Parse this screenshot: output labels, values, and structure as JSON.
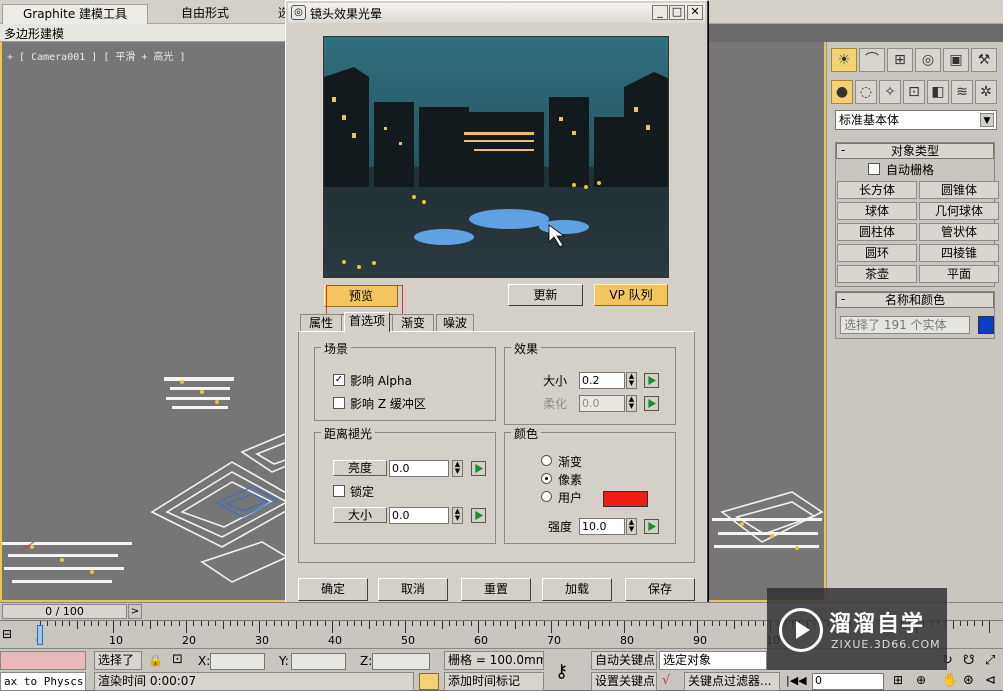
{
  "ribbon": {
    "tabs": [
      "Graphite 建模工具",
      "自由形式",
      "选"
    ],
    "subtab": "多边形建模"
  },
  "viewport": {
    "label": "+ [ Camera001 ] [ 平滑 + 高光 ]"
  },
  "dialog": {
    "title": "镜头效果光晕",
    "window_buttons": [
      "_",
      "□",
      "✕"
    ],
    "preview_button": "预览",
    "update_button": "更新",
    "vp_queue_button": "VP 队列",
    "tabs": [
      "属性",
      "首选项",
      "渐变",
      "噪波"
    ],
    "active_tab": "首选项",
    "scene": {
      "title": "场景",
      "affect_alpha": {
        "label": "影响 Alpha",
        "checked": true
      },
      "affect_z": {
        "label": "影响 Z 缓冲区",
        "checked": false
      }
    },
    "distance_fade": {
      "title": "距离褪光",
      "brightness_label": "亮度",
      "brightness_value": "0.0",
      "lock_label": "锁定",
      "lock_checked": false,
      "size_label": "大小",
      "size_value": "0.0"
    },
    "effect": {
      "title": "效果",
      "size_label": "大小",
      "size_value": "0.2",
      "soften_label": "柔化",
      "soften_value": "0.0"
    },
    "color": {
      "title": "颜色",
      "options": [
        "渐变",
        "像素",
        "用户"
      ],
      "selected": "像素",
      "user_color": "#ee1c14",
      "intensity_label": "强度",
      "intensity_value": "10.0"
    },
    "footer_buttons": [
      "确定",
      "取消",
      "重置",
      "加载",
      "保存"
    ]
  },
  "command_panel": {
    "tab_icons": [
      "sun-icon",
      "curve-icon",
      "hierarchy-icon",
      "motion-icon",
      "display-icon",
      "hammer-icon"
    ],
    "create_icons": [
      "sphere-icon",
      "shapes-icon",
      "light-icon",
      "camera-icon",
      "helper-icon",
      "spacewarp-icon",
      "systems-icon"
    ],
    "dropdown": "标准基本体",
    "object_type": {
      "title": "对象类型",
      "autogrid_label": "自动栅格",
      "buttons": [
        "长方体",
        "圆锥体",
        "球体",
        "几何球体",
        "圆柱体",
        "管状体",
        "圆环",
        "四棱锥",
        "茶壶",
        "平面"
      ]
    },
    "name_color": {
      "title": "名称和颜色",
      "field_value": "选择了 191 个实体",
      "swatch_color": "#0a3fc8"
    }
  },
  "timeline": {
    "frame": "0 / 100",
    "ticks": [
      "0",
      "10",
      "20",
      "30",
      "40",
      "50",
      "60",
      "70",
      "80",
      "90",
      "10"
    ]
  },
  "status": {
    "script_listener": "ax to Physcs (",
    "selection": "选择了",
    "x_label": "X:",
    "y_label": "Y:",
    "z_label": "Z:",
    "grid": "栅格 = 100.0mm",
    "auto_key": "自动关键点",
    "set_key": "设置关键点",
    "selected_object": "选定对象",
    "key_filter": "关键点过滤器...",
    "render_time": "渲染时间  0:00:07",
    "add_time_tag": "添加时间标记",
    "frame_field": "0"
  },
  "watermark": {
    "title": "溜溜自学",
    "url": "ZIXUE.3D66.COM"
  }
}
